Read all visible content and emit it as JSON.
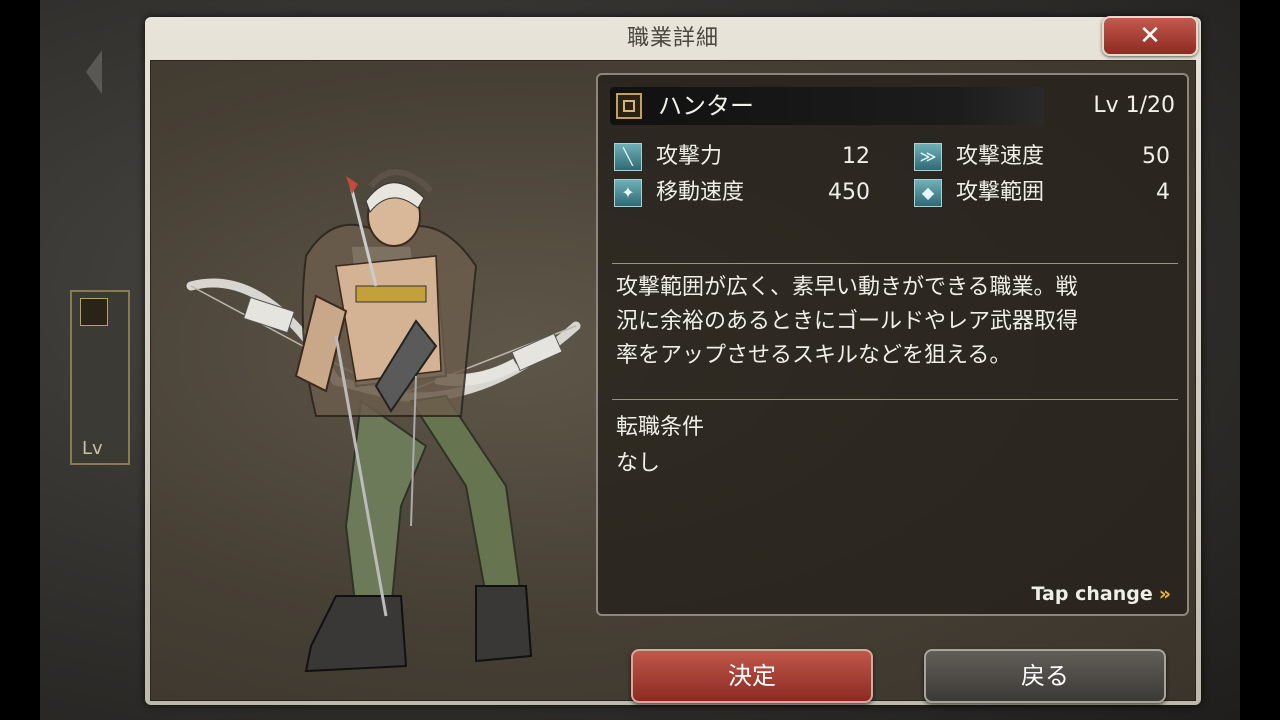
{
  "background": {
    "card_level_text": "Lv"
  },
  "dialog": {
    "title": "職業詳細",
    "close_label": "✕"
  },
  "job": {
    "name": "ハンター",
    "level": "Lv 1/20"
  },
  "stats": [
    {
      "label": "攻撃力",
      "value": "12",
      "icon": "sword-icon"
    },
    {
      "label": "攻撃速度",
      "value": "50",
      "icon": "speed-icon"
    },
    {
      "label": "移動速度",
      "value": "450",
      "icon": "wing-icon"
    },
    {
      "label": "攻撃範囲",
      "value": "4",
      "icon": "range-icon"
    }
  ],
  "description": {
    "line1": "攻撃範囲が広く、素早い動きができる職業。戦",
    "line2": "況に余裕のあるときにゴールドやレア武器取得",
    "line3": "率をアップさせるスキルなどを狙える。"
  },
  "condition": {
    "label": "転職条件",
    "value": "なし"
  },
  "tap_change": "Tap change",
  "buttons": {
    "confirm": "決定",
    "back": "戻る"
  },
  "colors": {
    "confirm_button": "#a8403a",
    "back_button": "#4e4b46",
    "stat_icon": "#4f8e98",
    "accent_arrow": "#f0b030"
  }
}
